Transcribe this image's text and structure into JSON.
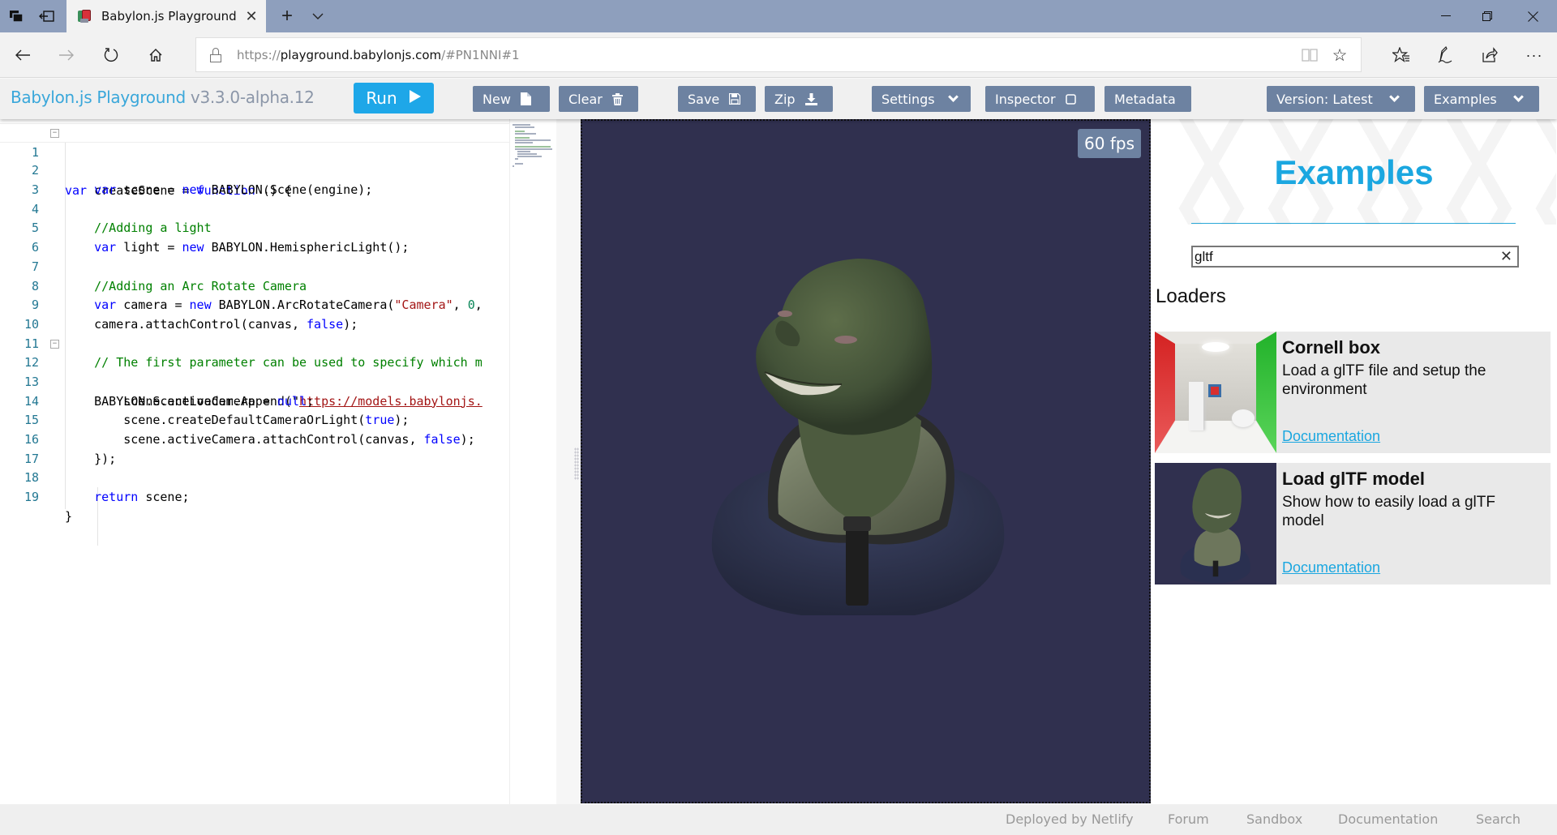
{
  "browser": {
    "tab_title": "Babylon.js Playground",
    "url_scheme": "https://",
    "url_host": "playground.babylonjs.com",
    "url_path": "/#PN1NNI#1",
    "icons": {
      "tab_actions": "tab-set-aside-icon",
      "back": "back-arrow-icon",
      "forward": "forward-arrow-icon",
      "refresh": "refresh-icon",
      "home": "home-icon",
      "reading_view": "reading-view-icon",
      "favorite": "star-icon",
      "favorites_hub": "favorites-list-icon",
      "notes": "pen-icon",
      "share": "share-icon",
      "more": "more-icon"
    }
  },
  "toolbar": {
    "brand": "Babylon.js Playground",
    "version": "v3.3.0-alpha.12",
    "run": "Run",
    "new": "New",
    "clear": "Clear",
    "save": "Save",
    "zip": "Zip",
    "settings": "Settings",
    "inspector": "Inspector",
    "metadata": "Metadata",
    "version_select": "Version: Latest",
    "examples": "Examples"
  },
  "editor": {
    "lines": [
      {
        "n": "1",
        "fold": true
      },
      {
        "n": "2"
      },
      {
        "n": "3"
      },
      {
        "n": "4"
      },
      {
        "n": "5"
      },
      {
        "n": "6"
      },
      {
        "n": "7"
      },
      {
        "n": "8"
      },
      {
        "n": "9"
      },
      {
        "n": "10"
      },
      {
        "n": "11"
      },
      {
        "n": "12",
        "fold": true
      },
      {
        "n": "13"
      },
      {
        "n": "14"
      },
      {
        "n": "15"
      },
      {
        "n": "16"
      },
      {
        "n": "17"
      },
      {
        "n": "18"
      },
      {
        "n": "19"
      }
    ],
    "code": {
      "l1_var": "var",
      "l1_name": " createScene = ",
      "l1_fn": "function",
      "l1_rest": " () {",
      "l2_var": "var",
      "l2_a": " scene = ",
      "l2_new": "new",
      "l2_b": " BABYLON.Scene(engine);",
      "l4": "//Adding a light",
      "l5_var": "var",
      "l5_a": " light = ",
      "l5_new": "new",
      "l5_b": " BABYLON.HemisphericLight();",
      "l7": "//Adding an Arc Rotate Camera",
      "l8_var": "var",
      "l8_a": " camera = ",
      "l8_new": "new",
      "l8_b": " BABYLON.ArcRotateCamera(",
      "l8_str": "\"Camera\"",
      "l8_c": ", ",
      "l8_num": "0",
      "l8_d": ",",
      "l9_a": "camera.attachControl(canvas, ",
      "l9_false": "false",
      "l9_b": ");",
      "l11": "// The first parameter can be used to specify which m",
      "l12_a": "BABYLON.SceneLoader.Append(\"",
      "l12_url": "https://models.babylonjs.",
      "l13_a": "scene.activeCamera = ",
      "l13_null": "null",
      "l13_b": ";",
      "l14_a": "scene.createDefaultCameraOrLight(",
      "l14_true": "true",
      "l14_b": ");",
      "l15_a": "scene.activeCamera.attachControl(canvas, ",
      "l15_false": "false",
      "l15_b": ");",
      "l16": "});",
      "l18_ret": "return",
      "l18_b": " scene;",
      "l19": "}"
    }
  },
  "canvas": {
    "fps": "60 fps",
    "background": "#30304f"
  },
  "examples_panel": {
    "title": "Examples",
    "search_value": "gltf",
    "category": "Loaders",
    "items": [
      {
        "name": "Cornell box",
        "description": "Load a glTF file and setup the environment",
        "link": "Documentation"
      },
      {
        "name": "Load glTF model",
        "description": "Show how to easily load a glTF model",
        "link": "Documentation"
      }
    ]
  },
  "footer": {
    "links": [
      "Deployed by Netlify",
      "Forum",
      "Sandbox",
      "Documentation",
      "Search"
    ]
  },
  "colors": {
    "accent": "#1ea7e8",
    "button": "#6d82a1",
    "chrome_titlebar": "#8e9fbd"
  }
}
